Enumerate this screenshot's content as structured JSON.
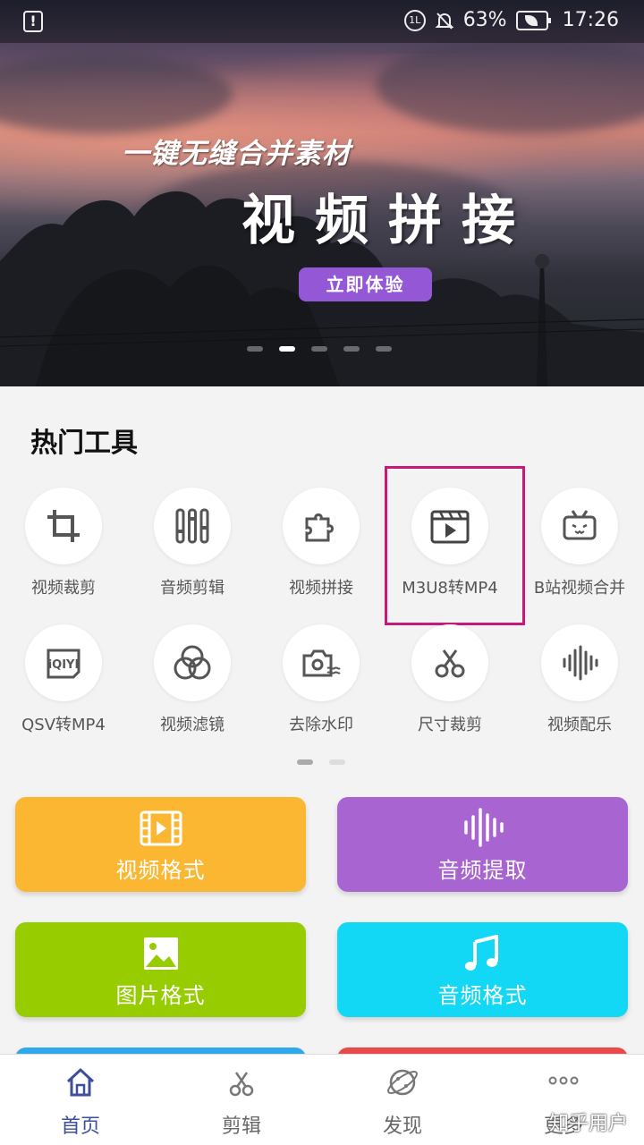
{
  "status_bar": {
    "battery_percent": "63%",
    "time": "17:26"
  },
  "banner": {
    "subtitle": "一键无缝合并素材",
    "title": "视频拼接",
    "button_label": "立即体验",
    "slides_total": 5,
    "active_slide": 2
  },
  "hot_tools": {
    "title": "热门工具",
    "items": [
      {
        "label": "视频裁剪",
        "icon": "crop-icon"
      },
      {
        "label": "音频剪辑",
        "icon": "equalizer-icon"
      },
      {
        "label": "视频拼接",
        "icon": "puzzle-icon"
      },
      {
        "label": "M3U8转MP4",
        "icon": "video-play-icon"
      },
      {
        "label": "B站视频合并",
        "icon": "bilibili-tv-icon"
      },
      {
        "label": "QSV转MP4",
        "icon": "iqiyi-icon"
      },
      {
        "label": "视频滤镜",
        "icon": "filter-circles-icon"
      },
      {
        "label": "去除水印",
        "icon": "camera-wave-icon"
      },
      {
        "label": "尺寸裁剪",
        "icon": "scissors-icon"
      },
      {
        "label": "视频配乐",
        "icon": "soundwave-icon"
      }
    ],
    "highlighted_item": "M3U8转MP4",
    "pages_total": 2,
    "active_page": 1
  },
  "format_cards": [
    {
      "label": "视频格式",
      "icon": "film-strip-icon",
      "color": "#fbb731"
    },
    {
      "label": "音频提取",
      "icon": "audio-bars-icon",
      "color": "#a865d2"
    },
    {
      "label": "图片格式",
      "icon": "image-icon",
      "color": "#96cc00"
    },
    {
      "label": "音频格式",
      "icon": "music-note-icon",
      "color": "#13d8f5"
    }
  ],
  "bottom_nav": {
    "items": [
      {
        "label": "首页",
        "icon": "home-icon",
        "active": true
      },
      {
        "label": "剪辑",
        "icon": "scissors-icon",
        "active": false
      },
      {
        "label": "发现",
        "icon": "planet-icon",
        "active": false
      },
      {
        "label": "更多",
        "icon": "more-dots-icon",
        "active": false
      }
    ],
    "active_color": "#3d4f9a"
  },
  "watermark": "知乎用户"
}
